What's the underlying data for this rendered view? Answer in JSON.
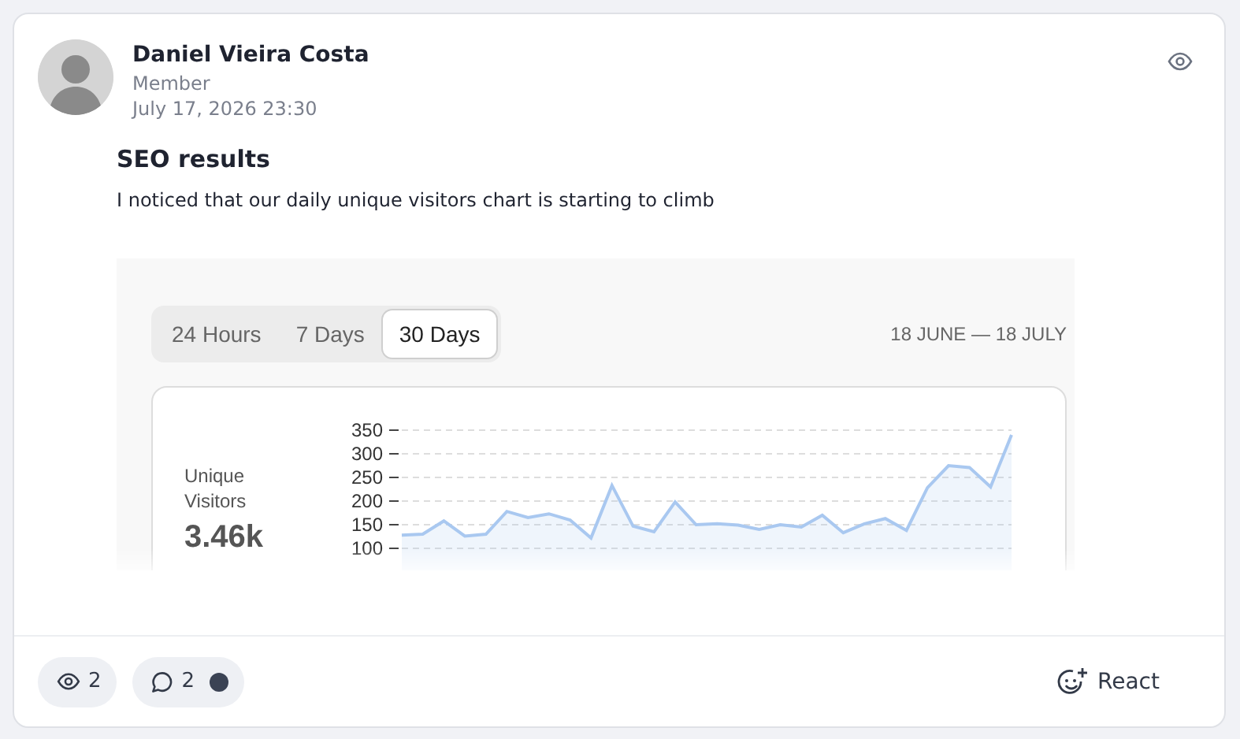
{
  "post": {
    "author": {
      "name": "Daniel Vieira Costa",
      "role": "Member",
      "timestamp": "July 17, 2026 23:30"
    },
    "title": "SEO results",
    "body": "I noticed that our daily unique visitors chart is starting to climb",
    "embed": {
      "tabs": [
        {
          "label": "24 Hours",
          "selected": false
        },
        {
          "label": "7 Days",
          "selected": false
        },
        {
          "label": "30 Days",
          "selected": true
        }
      ],
      "date_range": "18 JUNE — 18 JULY",
      "stat": {
        "value": "3.46k"
      },
      "chart_data": {
        "type": "area",
        "grid": true,
        "yticks": [
          100,
          150,
          200,
          250,
          300,
          350
        ],
        "ylim": [
          100,
          350
        ],
        "series": [
          {
            "name": "Unique Visitors",
            "color": "#a9c8f0",
            "values": [
              128,
              130,
              158,
              126,
              130,
              178,
              165,
              173,
              160,
              122,
              233,
              147,
              135,
              198,
              150,
              152,
              149,
              140,
              150,
              145,
              170,
              133,
              152,
              163,
              138,
              228,
              275,
              271,
              230,
              340
            ]
          }
        ]
      }
    },
    "footer": {
      "views": "2",
      "comments": "2",
      "has_unread": true,
      "react": "React"
    }
  }
}
